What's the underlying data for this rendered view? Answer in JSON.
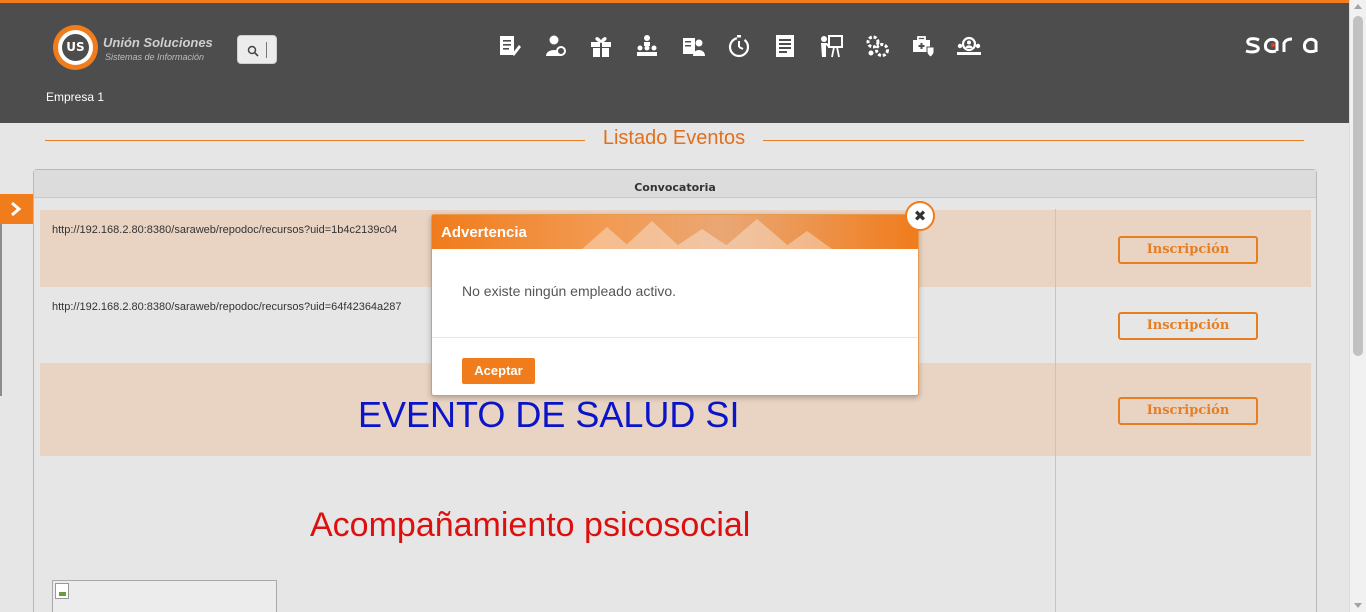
{
  "header": {
    "logo": {
      "mark": "US",
      "title": "Unión Soluciones",
      "subtitle": "Sistemas de Información"
    },
    "company": "Empresa 1",
    "brand": "sara",
    "nav_icons": [
      "document-edit-icon",
      "user-settings-icon",
      "gift-icon",
      "org-chart-icon",
      "user-id-icon",
      "timer-icon",
      "form-list-icon",
      "presentation-icon",
      "gears-icon",
      "medical-kit-icon",
      "group-search-icon"
    ]
  },
  "page": {
    "title": "Listado Eventos"
  },
  "table": {
    "header": "Convocatoria",
    "rows": [
      {
        "url": "http://192.168.2.80:8380/saraweb/repodoc/recursos?uid=1b4c2139c04",
        "button": "Inscripción"
      },
      {
        "url": "http://192.168.2.80:8380/saraweb/repodoc/recursos?uid=64f42364a287",
        "button": "Inscripción"
      },
      {
        "text": "EVENTO DE SALUD SI",
        "button": "Inscripción"
      },
      {
        "text": "Acompañamiento psicosocial"
      }
    ]
  },
  "modal": {
    "title": "Advertencia",
    "message": "No existe ningún empleado activo.",
    "accept": "Aceptar",
    "close": "✖"
  },
  "colors": {
    "accent": "#f07c1c",
    "header_bg": "#4d4d4d",
    "row_alt": "#e9d4c4",
    "blue_text": "#0a14c8",
    "red_text": "#dd1010"
  }
}
